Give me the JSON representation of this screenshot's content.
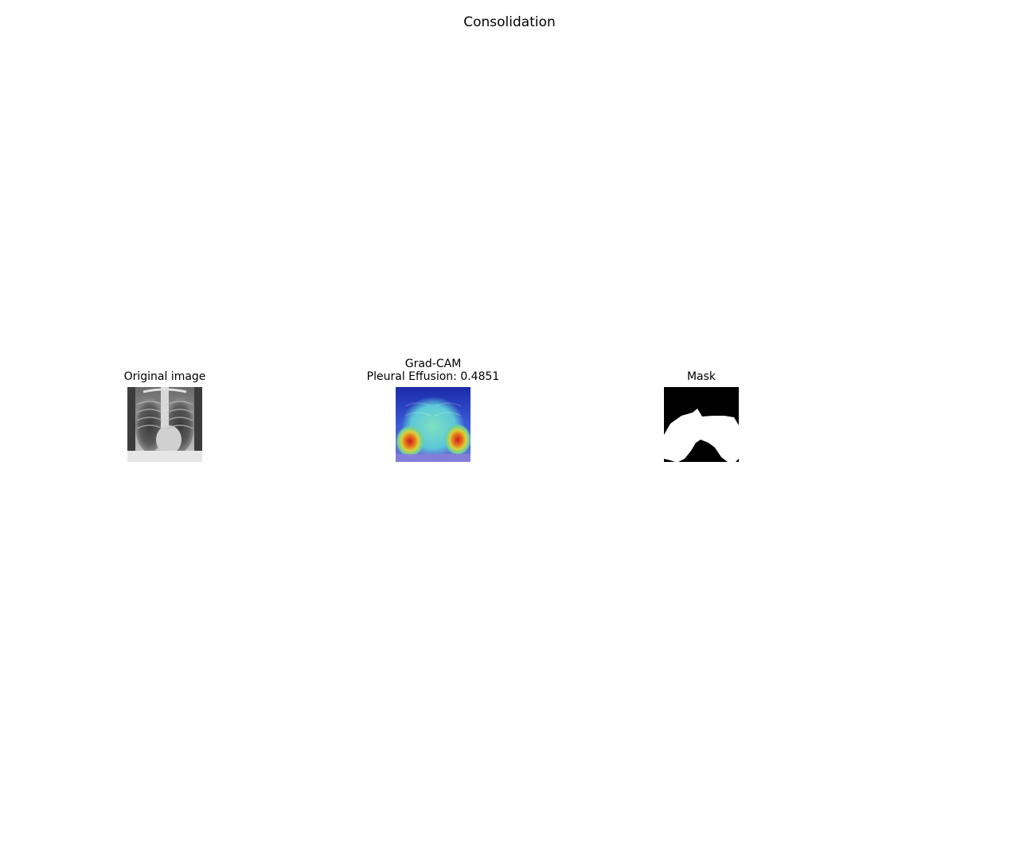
{
  "figure": {
    "title": "Consolidation"
  },
  "panels": [
    {
      "title_lines": [
        "Original image"
      ]
    },
    {
      "title_lines": [
        "Grad-CAM",
        "Pleural Effusion: 0.4851"
      ]
    },
    {
      "title_lines": [
        "Mask"
      ]
    }
  ],
  "colors": {
    "background": "#ffffff",
    "text": "#000000",
    "mask_background": "#000000",
    "mask_foreground": "#ffffff"
  }
}
